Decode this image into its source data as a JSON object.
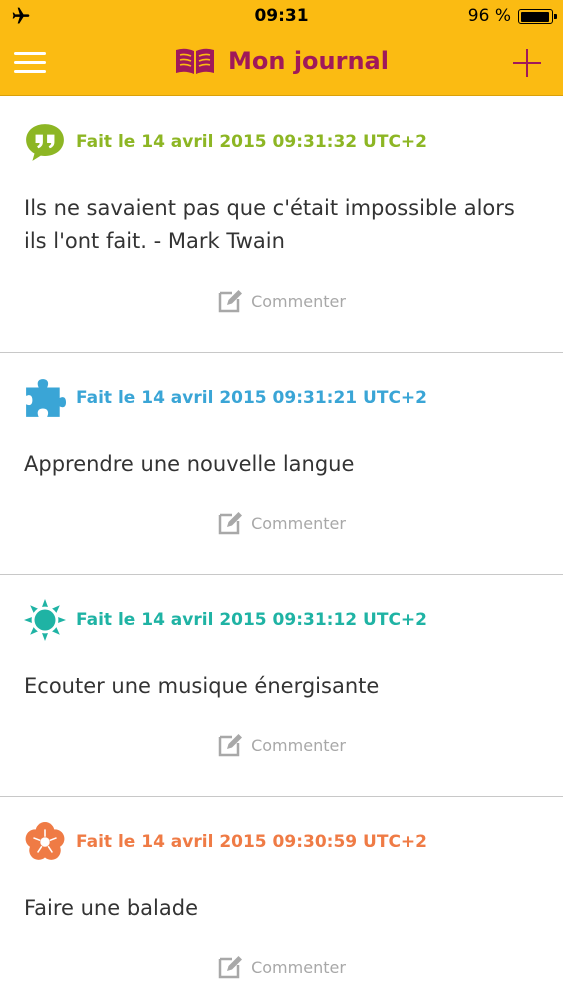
{
  "status_bar": {
    "time": "09:31",
    "battery": "96 %"
  },
  "header": {
    "title": "Mon journal",
    "title_color": "#a0195a",
    "background": "#fbbb12"
  },
  "entries": [
    {
      "icon": "quote-icon",
      "color": "#8db624",
      "date": "Fait le 14 avril 2015 09:31:32 UTC+2",
      "text": "Ils ne savaient pas que c'était impossible alors ils l'ont fait. - Mark Twain",
      "comment_label": "Commenter"
    },
    {
      "icon": "puzzle-icon",
      "color": "#3aa5d6",
      "date": "Fait le 14 avril 2015 09:31:21 UTC+2",
      "text": "Apprendre une nouvelle langue",
      "comment_label": "Commenter"
    },
    {
      "icon": "sun-icon",
      "color": "#1fb3a4",
      "date": "Fait le 14 avril 2015 09:31:12 UTC+2",
      "text": "Ecouter une musique énergisante",
      "comment_label": "Commenter"
    },
    {
      "icon": "flower-icon",
      "color": "#ef7b45",
      "date": "Fait le 14 avril 2015 09:30:59 UTC+2",
      "text": "Faire une balade",
      "comment_label": "Commenter"
    }
  ]
}
